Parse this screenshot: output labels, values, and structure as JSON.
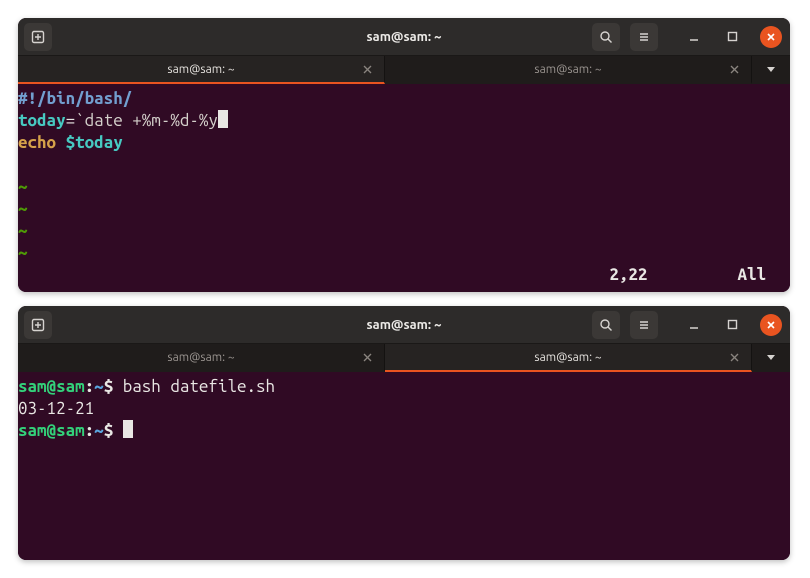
{
  "window1": {
    "titlebar": {
      "title": "sam@sam: ~"
    },
    "tabs": [
      {
        "label": "sam@sam: ~",
        "active": true
      },
      {
        "label": "sam@sam: ~",
        "active": false
      }
    ],
    "editor": {
      "line1_shebang": "#!/bin/bash/",
      "line2_var": "today",
      "line2_eq": "=",
      "line2_cmd": "`date +%m-%d-%y",
      "line3_echo": "echo",
      "line3_space": " ",
      "line3_var": "$today",
      "tilde": "~"
    },
    "status": {
      "pos": "2,22",
      "scroll": "All"
    }
  },
  "window2": {
    "titlebar": {
      "title": "sam@sam: ~"
    },
    "tabs": [
      {
        "label": "sam@sam: ~",
        "active": false
      },
      {
        "label": "sam@sam: ~",
        "active": true
      }
    ],
    "shell": {
      "prompt_userhost": "sam@sam",
      "prompt_colon": ":",
      "prompt_path": "~",
      "prompt_dollar": "$ ",
      "line1_cmd": "bash datefile.sh",
      "line2_out": "03-12-21"
    }
  }
}
